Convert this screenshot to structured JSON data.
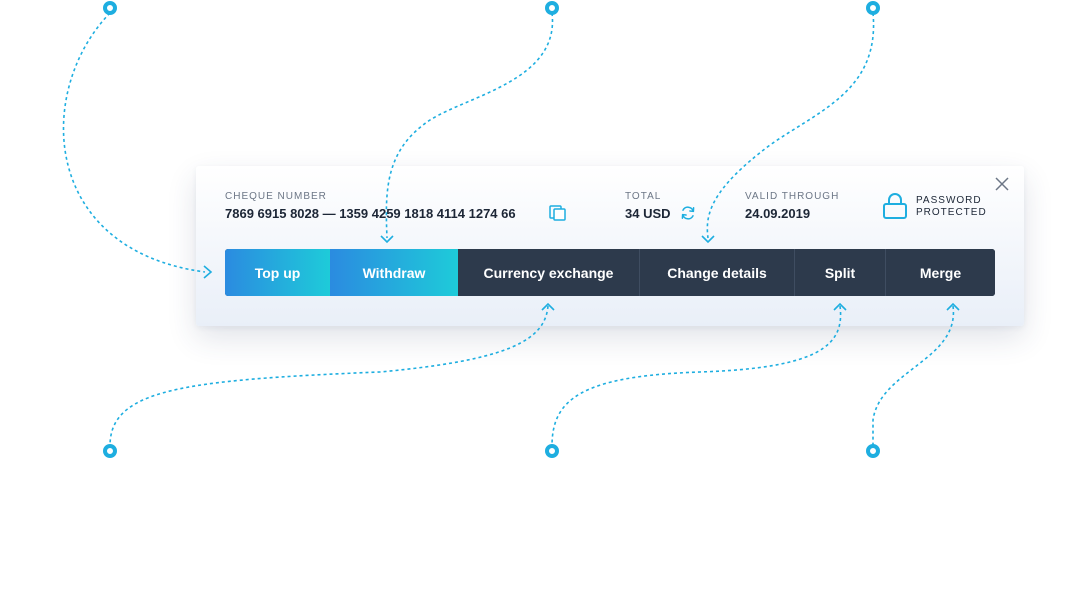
{
  "card": {
    "cheque": {
      "label": "CHEQUE NUMBER",
      "value": "7869 6915 8028 — 1359 4259 1818 4114 1274 66"
    },
    "total": {
      "label": "TOTAL",
      "value": "34 USD"
    },
    "valid": {
      "label": "VALID THROUGH",
      "value": "24.09.2019"
    },
    "lock": {
      "line1": "PASSWORD",
      "line2": "PROTECTED"
    }
  },
  "tabs": [
    {
      "label": "Top up"
    },
    {
      "label": "Withdraw"
    },
    {
      "label": "Currency exchange"
    },
    {
      "label": "Change details"
    },
    {
      "label": "Split"
    },
    {
      "label": "Merge"
    }
  ],
  "icons": {
    "copy": "copy-icon",
    "refresh": "refresh-icon",
    "lock": "lock-icon",
    "close": "close-icon"
  },
  "colors": {
    "accent": "#1eaee0",
    "tab_dark": "#2d3a4c",
    "gradient_start": "#2b8be0",
    "gradient_end": "#1ecbd9",
    "text_dark": "#1c2636",
    "text_muted": "#6c7686"
  }
}
